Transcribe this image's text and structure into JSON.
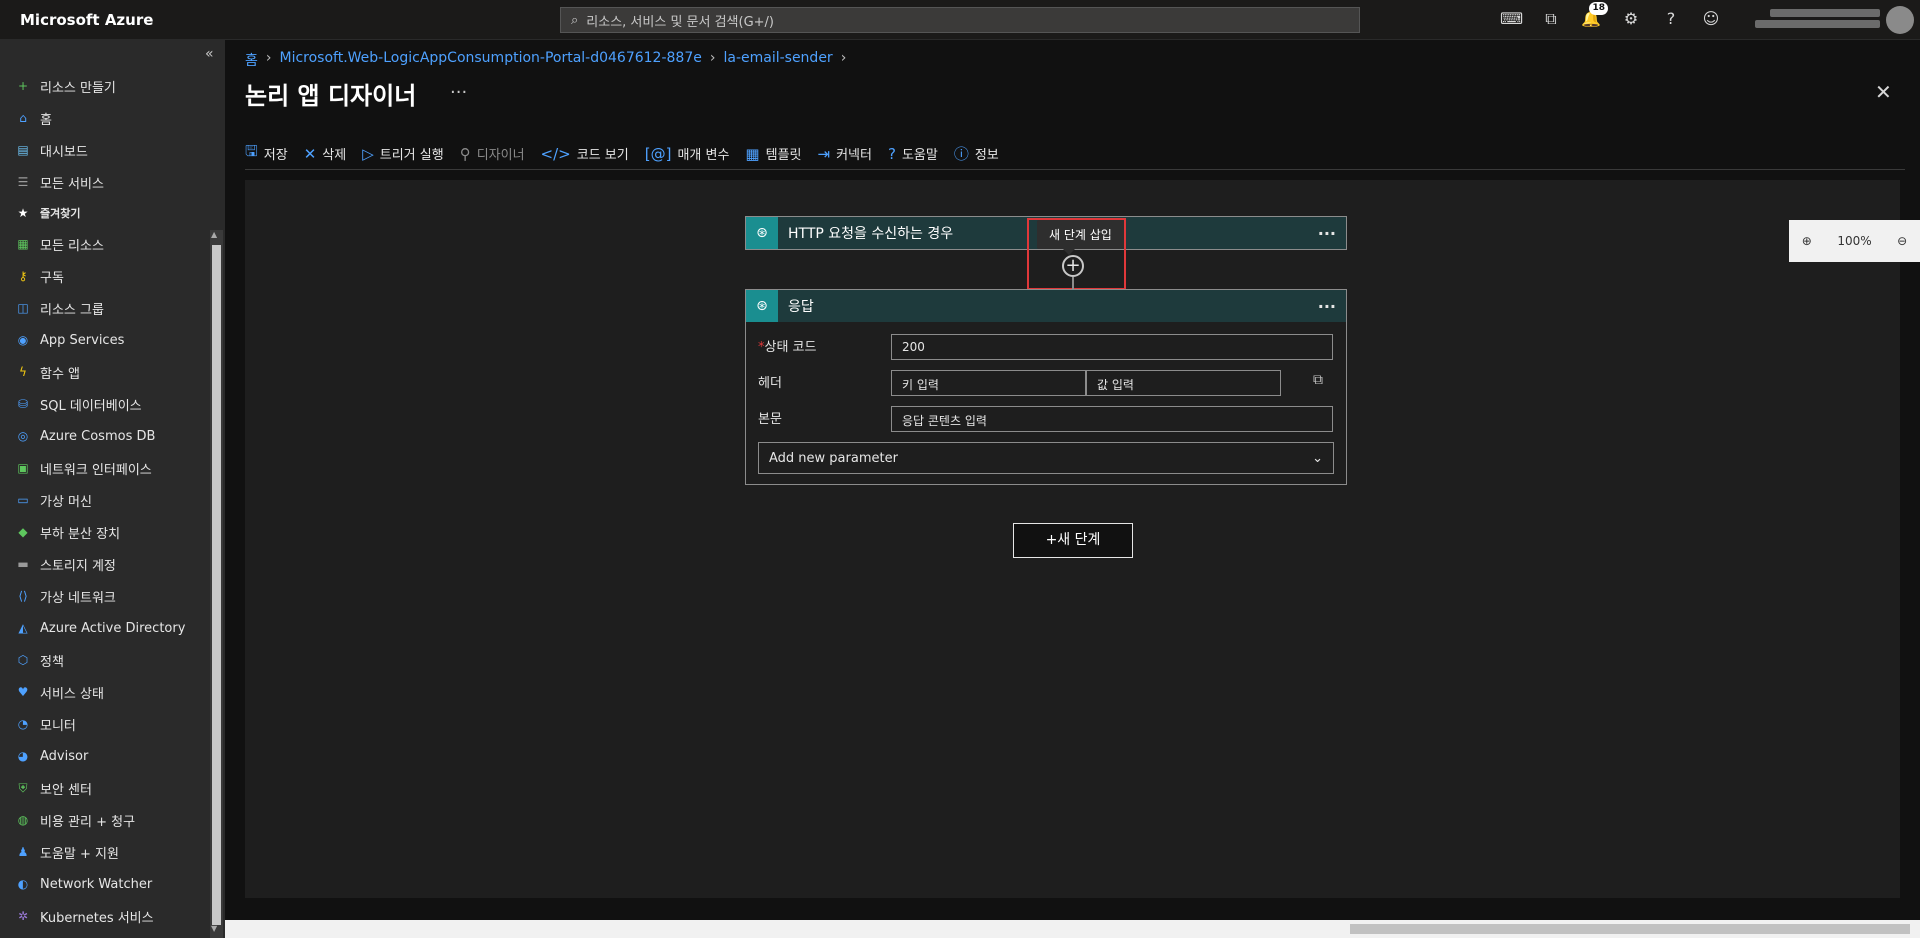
{
  "topbar": {
    "brand": "Microsoft Azure",
    "search_placeholder": "리소스, 서비스 및 문서 검색(G+/)",
    "notification_count": "18",
    "icons": [
      "cloud-shell-icon",
      "directory-filter-icon",
      "bell-icon",
      "gear-icon",
      "help-icon",
      "feedback-icon"
    ]
  },
  "sidebar": {
    "collapse_glyph": "«",
    "items": [
      {
        "label": "리소스 만들기",
        "icon": "plus-icon",
        "color": "#5ec75e"
      },
      {
        "label": "홈",
        "icon": "home-icon",
        "color": "#4ea1ff"
      },
      {
        "label": "대시보드",
        "icon": "dashboard-icon",
        "color": "#6cc0f0"
      },
      {
        "label": "모든 서비스",
        "icon": "list-icon",
        "color": "#9a9a9a"
      },
      {
        "label": "즐겨찾기",
        "icon": "star-icon",
        "color": "#ffffff"
      },
      {
        "label": "모든 리소스",
        "icon": "grid-icon",
        "color": "#5ec75e"
      },
      {
        "label": "구독",
        "icon": "key-icon",
        "color": "#f2c811"
      },
      {
        "label": "리소스 그룹",
        "icon": "resource-group-icon",
        "color": "#4ea1ff"
      },
      {
        "label": "App Services",
        "icon": "globe-icon",
        "color": "#4ea1ff"
      },
      {
        "label": "함수 앱",
        "icon": "lightning-icon",
        "color": "#f2c811"
      },
      {
        "label": "SQL 데이터베이스",
        "icon": "database-icon",
        "color": "#4ea1ff"
      },
      {
        "label": "Azure Cosmos DB",
        "icon": "planet-icon",
        "color": "#4ea1ff"
      },
      {
        "label": "네트워크 인터페이스",
        "icon": "network-interface-icon",
        "color": "#5ec75e"
      },
      {
        "label": "가상 머신",
        "icon": "monitor-icon",
        "color": "#4ea1ff"
      },
      {
        "label": "부하 분산 장치",
        "icon": "diamond-icon",
        "color": "#5ec75e"
      },
      {
        "label": "스토리지 계정",
        "icon": "storage-icon",
        "color": "#9a9a9a"
      },
      {
        "label": "가상 네트워크",
        "icon": "vnet-icon",
        "color": "#4ea1ff"
      },
      {
        "label": "Azure Active Directory",
        "icon": "aad-icon",
        "color": "#4ea1ff"
      },
      {
        "label": "정책",
        "icon": "policy-icon",
        "color": "#4ea1ff"
      },
      {
        "label": "서비스 상태",
        "icon": "heartbeat-icon",
        "color": "#4ea1ff"
      },
      {
        "label": "모니터",
        "icon": "gauge-icon",
        "color": "#4ea1ff"
      },
      {
        "label": "Advisor",
        "icon": "advisor-icon",
        "color": "#4ea1ff"
      },
      {
        "label": "보안 센터",
        "icon": "shield-icon",
        "color": "#5ec75e"
      },
      {
        "label": "비용 관리 + 청구",
        "icon": "cost-icon",
        "color": "#5ec75e"
      },
      {
        "label": "도움말 + 지원",
        "icon": "person-icon",
        "color": "#4ea1ff"
      },
      {
        "label": "Network Watcher",
        "icon": "globe-watch-icon",
        "color": "#4ea1ff"
      },
      {
        "label": "Kubernetes 서비스",
        "icon": "kubernetes-icon",
        "color": "#9b7ad8"
      }
    ]
  },
  "breadcrumb": {
    "home": "홈",
    "resource_group": "Microsoft.Web-LogicAppConsumption-Portal-d0467612-887e",
    "resource": "la-email-sender"
  },
  "page": {
    "title": "논리 앱 디자이너",
    "more": "···",
    "close": "✕"
  },
  "toolbar": {
    "save": "저장",
    "delete": "삭제",
    "run_trigger": "트리거 실행",
    "designer": "디자이너",
    "code_view": "코드 보기",
    "parameters": "매개 변수",
    "templates": "템플릿",
    "connectors": "커넥터",
    "help": "도움말",
    "info": "정보"
  },
  "zoom": {
    "level": "100%"
  },
  "trigger_card": {
    "title": "HTTP 요청을 수신하는 경우",
    "more": "···"
  },
  "insert_step": {
    "tooltip": "새 단계 삽입",
    "plus": "+"
  },
  "response_card": {
    "title": "응답",
    "more": "···",
    "status_label": "상태 코드",
    "status_required_mark": "*",
    "status_value": "200",
    "headers_label": "헤더",
    "header_key_placeholder": "키 입력",
    "header_value_placeholder": "값 입력",
    "body_label": "본문",
    "body_placeholder": "응답 콘텐츠 입력",
    "add_param": "Add new parameter"
  },
  "new_step": {
    "label": "+새 단계"
  }
}
